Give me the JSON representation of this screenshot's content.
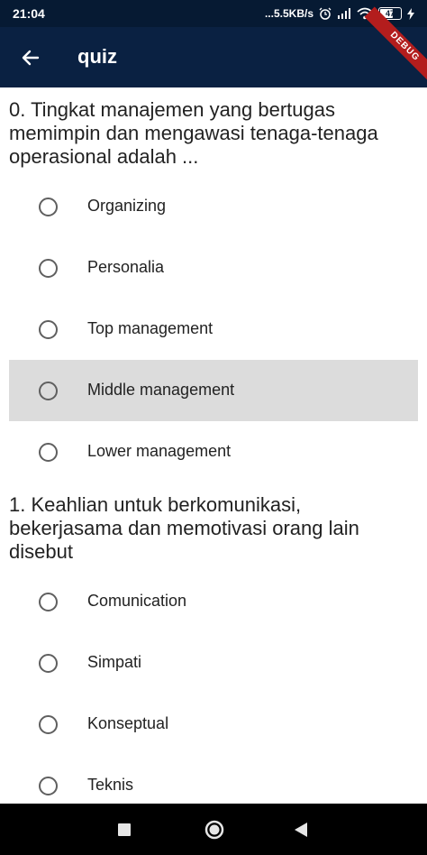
{
  "status_bar": {
    "time": "21:04",
    "network_speed": "...5.5KB/s",
    "battery_level": "47",
    "icons": [
      "alarm-icon",
      "signal-icon",
      "wifi-icon",
      "battery-icon",
      "charging-icon"
    ]
  },
  "debug_banner": "DEBUG",
  "app_bar": {
    "title": "quiz",
    "back_icon": "arrow-left-icon"
  },
  "questions": [
    {
      "text": "0. Tingkat manajemen yang bertugas memimpin dan mengawasi tenaga-tenaga operasional adalah ...",
      "options": [
        "Organizing",
        "Personalia",
        "Top management",
        "Middle management",
        "Lower management"
      ],
      "highlighted_option": "Middle management"
    },
    {
      "text": "1. Keahlian untuk berkomunikasi, bekerjasama dan memotivasi orang lain disebut",
      "options": [
        "Comunication",
        "Simpati",
        "Konseptual",
        "Teknis"
      ]
    }
  ],
  "nav_bar": {
    "icons": [
      "recent-apps-icon",
      "home-icon",
      "back-icon"
    ]
  }
}
